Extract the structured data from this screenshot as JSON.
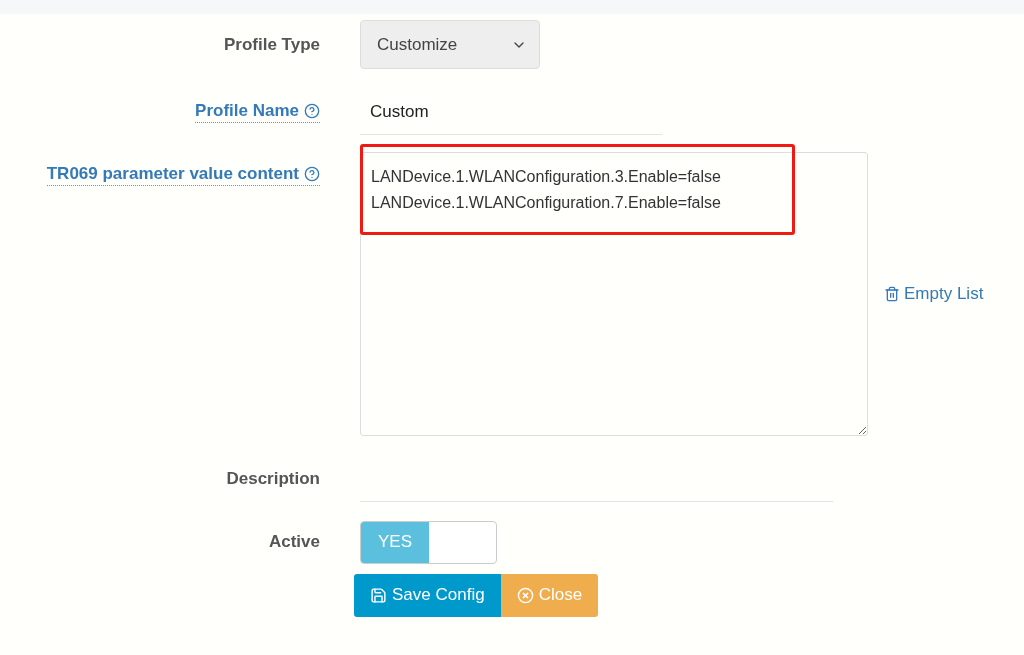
{
  "form": {
    "profile_type": {
      "label": "Profile Type",
      "value": "Customize"
    },
    "profile_name": {
      "label": "Profile Name",
      "value": "Custom"
    },
    "parameters": {
      "label": "TR069 parameter value content",
      "lines": [
        "LANDevice.1.WLANConfiguration.3.Enable=false",
        "LANDevice.1.WLANConfiguration.7.Enable=false"
      ],
      "highlighted": true
    },
    "empty_list": {
      "label": "Empty List"
    },
    "description": {
      "label": "Description"
    },
    "active": {
      "label": "Active",
      "on": true,
      "state_label": "YES"
    }
  },
  "buttons": [
    {
      "kind": "save",
      "label": "Save Config"
    },
    {
      "kind": "close",
      "label": "Close"
    }
  ]
}
